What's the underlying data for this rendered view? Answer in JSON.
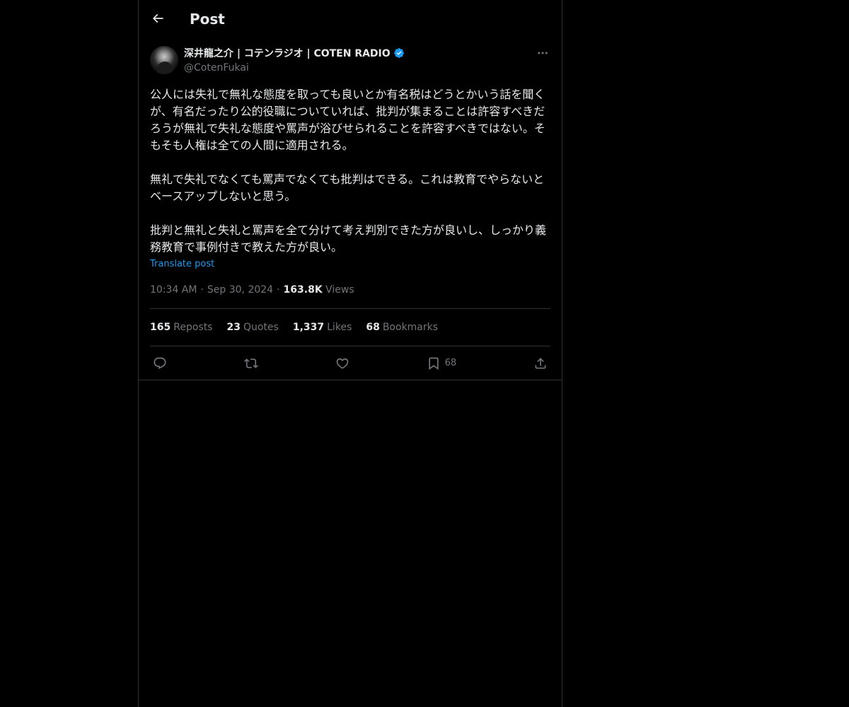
{
  "header": {
    "title": "Post",
    "back_icon": "arrow-left-icon"
  },
  "author": {
    "display_name": "深井龍之介 | コテンラジオ | COTEN RADIO",
    "handle": "@CotenFukai",
    "verified": true,
    "verified_color": "#1d9bf0"
  },
  "post": {
    "text": "公人には失礼で無礼な態度を取っても良いとか有名税はどうとかいう話を聞くが、有名だったり公的役職についていれば、批判が集まることは許容すべきだろうが無礼で失礼な態度や罵声が浴びせられることを許容すべきではない。そもそも人権は全ての人間に適用される。\n\n無礼で失礼でなくても罵声でなくても批判はできる。これは教育でやらないとベースアップしないと思う。\n\n批判と無礼と失礼と罵声を全て分けて考え判別できた方が良いし、しっかり義務教育で事例付きで教えた方が良い。",
    "translate_label": "Translate post",
    "time": "10:34 AM",
    "date": "Sep 30, 2024",
    "views_count": "163.8K",
    "views_label": "Views"
  },
  "stats": [
    {
      "count": "165",
      "label": "Reposts"
    },
    {
      "count": "23",
      "label": "Quotes"
    },
    {
      "count": "1,337",
      "label": "Likes"
    },
    {
      "count": "68",
      "label": "Bookmarks"
    }
  ],
  "actions": {
    "reply_icon": "reply-icon",
    "repost_icon": "repost-icon",
    "like_icon": "heart-icon",
    "bookmark_icon": "bookmark-icon",
    "bookmark_count": "68",
    "share_icon": "share-icon"
  },
  "colors": {
    "background": "#000000",
    "text": "#e7e9ea",
    "secondary": "#71767b",
    "accent": "#1d9bf0",
    "border": "#2f3336"
  }
}
